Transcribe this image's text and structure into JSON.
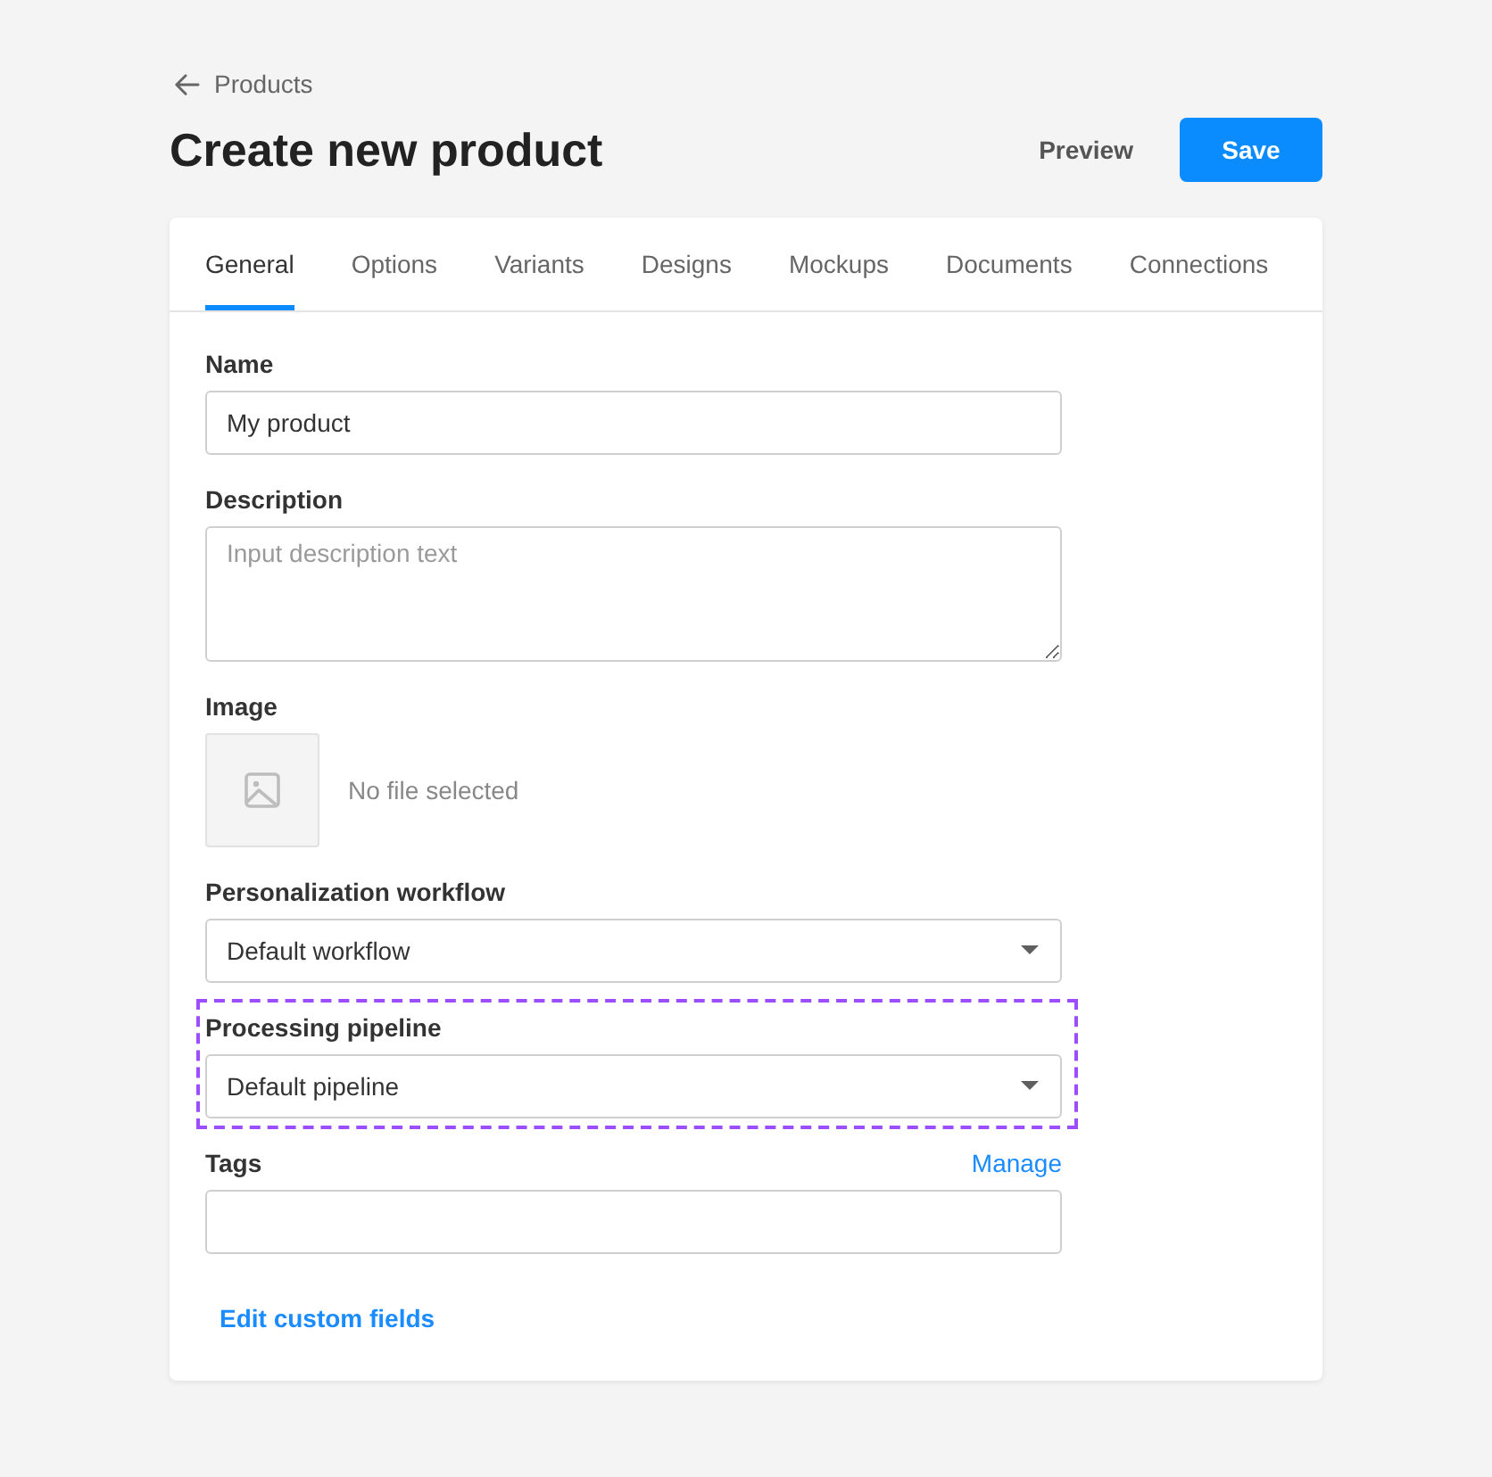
{
  "breadcrumb": {
    "label": "Products"
  },
  "title": "Create new product",
  "actions": [
    {
      "kind": "secondary",
      "label": "Preview"
    },
    {
      "kind": "primary",
      "label": "Save"
    }
  ],
  "tabs": [
    {
      "label": "General",
      "selected": true
    },
    {
      "label": "Options",
      "selected": false
    },
    {
      "label": "Variants",
      "selected": false
    },
    {
      "label": "Designs",
      "selected": false
    },
    {
      "label": "Mockups",
      "selected": false
    },
    {
      "label": "Documents",
      "selected": false
    },
    {
      "label": "Connections",
      "selected": false
    }
  ],
  "fields": [
    {
      "kind": "text",
      "label": "Name",
      "value": "My product",
      "highlighted": false
    },
    {
      "kind": "textarea",
      "label": "Description",
      "placeholder": "Input description text",
      "highlighted": false
    },
    {
      "kind": "image",
      "label": "Image",
      "status": "No file selected",
      "highlighted": false
    },
    {
      "kind": "select",
      "label": "Personalization workflow",
      "value": "Default workflow",
      "highlighted": false
    },
    {
      "kind": "select",
      "label": "Processing pipeline",
      "value": "Default pipeline",
      "highlighted": true
    },
    {
      "kind": "text",
      "label": "Tags",
      "link": "Manage",
      "highlighted": false
    }
  ],
  "footer_link": {
    "label": "Edit custom fields"
  }
}
